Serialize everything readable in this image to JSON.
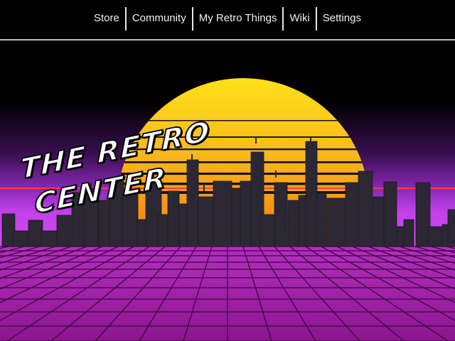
{
  "nav": {
    "items": [
      {
        "label": "Store"
      },
      {
        "label": "Community"
      },
      {
        "label": "My Retro Things"
      },
      {
        "label": "Wiki"
      },
      {
        "label": "Settings"
      }
    ]
  },
  "hero": {
    "title_line1": "The Retro",
    "title_line2": "Center"
  },
  "colors": {
    "sky": "#000000",
    "horizon_purple": "#c040e8",
    "sun_top": "#ffe21a",
    "sun_bottom": "#f07a10",
    "grid_floor": "#a01fa8",
    "grid_lines": "#3a0a3e",
    "buildings": "#2b2833",
    "neon_line": "#ff3b4a"
  }
}
